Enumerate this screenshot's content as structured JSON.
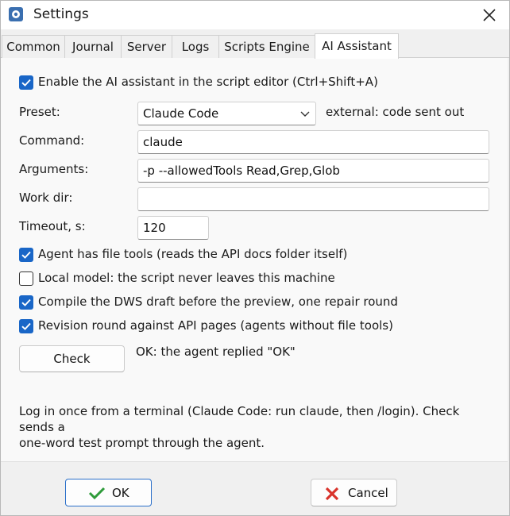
{
  "window": {
    "title": "Settings"
  },
  "tabs": [
    {
      "label": "Common"
    },
    {
      "label": "Journal"
    },
    {
      "label": "Server"
    },
    {
      "label": "Logs"
    },
    {
      "label": "Scripts Engine"
    },
    {
      "label": "AI Assistant",
      "active": true
    }
  ],
  "ai": {
    "enable_label": "Enable the AI assistant in the script editor (Ctrl+Shift+A)",
    "enable_checked": true,
    "preset_label": "Preset:",
    "preset_value": "Claude Code",
    "preset_note": "external: code sent out",
    "command_label": "Command:",
    "command_value": "claude",
    "arguments_label": "Arguments:",
    "arguments_value": "-p --allowedTools Read,Grep,Glob",
    "workdir_label": "Work dir:",
    "workdir_value": "",
    "timeout_label": "Timeout, s:",
    "timeout_value": "120",
    "options": [
      {
        "label": "Agent has file tools (reads the API docs folder itself)",
        "checked": true
      },
      {
        "label": "Local model: the script never leaves this machine",
        "checked": false
      },
      {
        "label": "Compile the DWS draft before the preview, one repair round",
        "checked": true
      },
      {
        "label": "Revision round against API pages (agents without file tools)",
        "checked": true
      }
    ],
    "check_button": "Check",
    "check_status": "OK: the agent replied \"OK\"",
    "help_line1": "Log in once from a terminal (Claude Code: run claude, then /login). Check sends a",
    "help_line2": "one-word test prompt through the agent."
  },
  "buttons": {
    "ok": "OK",
    "cancel": "Cancel"
  },
  "colors": {
    "accent": "#1966c7",
    "ok_check": "#2e9b3a",
    "cancel_x": "#d9332b"
  }
}
